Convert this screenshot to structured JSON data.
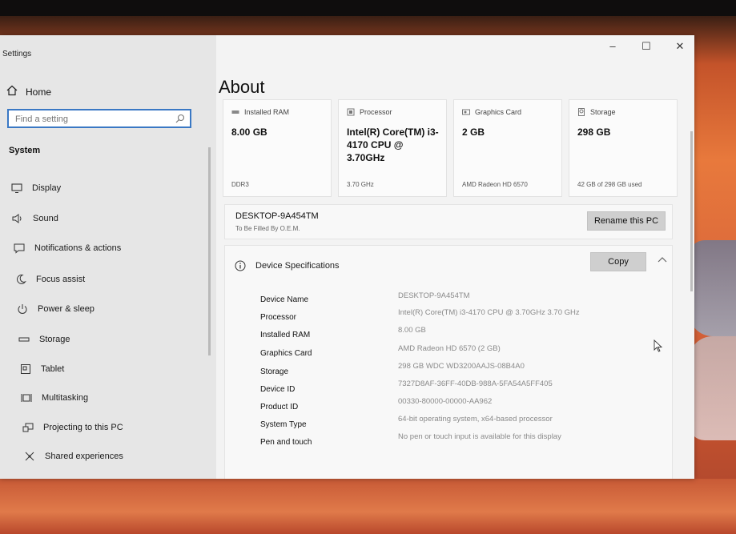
{
  "window": {
    "title": "Settings",
    "controls": {
      "minimize": "–",
      "maximize": "☐",
      "close": "✕"
    }
  },
  "sidebar": {
    "home_label": "Home",
    "search_placeholder": "Find a setting",
    "section_title": "System",
    "items": [
      {
        "label": "Display",
        "icon": "monitor-icon"
      },
      {
        "label": "Sound",
        "icon": "speaker-icon"
      },
      {
        "label": "Notifications & actions",
        "icon": "notification-icon"
      },
      {
        "label": "Focus assist",
        "icon": "moon-icon"
      },
      {
        "label": "Power & sleep",
        "icon": "power-icon"
      },
      {
        "label": "Storage",
        "icon": "storage-icon"
      },
      {
        "label": "Tablet",
        "icon": "tablet-icon"
      },
      {
        "label": "Multitasking",
        "icon": "multitasking-icon"
      },
      {
        "label": "Projecting to this PC",
        "icon": "projecting-icon"
      },
      {
        "label": "Shared experiences",
        "icon": "shared-icon"
      }
    ]
  },
  "main": {
    "title": "About",
    "cards": [
      {
        "label": "Installed RAM",
        "value": "8.00 GB",
        "sub": "DDR3",
        "icon": "ram-icon"
      },
      {
        "label": "Processor",
        "value": "Intel(R) Core(TM) i3-4170 CPU @ 3.70GHz",
        "sub": "3.70 GHz",
        "icon": "processor-icon"
      },
      {
        "label": "Graphics Card",
        "value": "2 GB",
        "sub": "AMD Radeon HD 6570",
        "icon": "graphics-card-icon"
      },
      {
        "label": "Storage",
        "value": "298 GB",
        "sub": "42 GB of 298 GB used",
        "icon": "storage-icon"
      }
    ],
    "pc": {
      "name": "DESKTOP-9A454TM",
      "subtitle": "To Be Filled By O.E.M.",
      "rename_label": "Rename this PC"
    },
    "specs": {
      "title": "Device Specifications",
      "copy_label": "Copy",
      "rows": [
        {
          "key": "Device Name",
          "value": "DESKTOP-9A454TM"
        },
        {
          "key": "Processor",
          "value": "Intel(R) Core(TM) i3-4170 CPU @ 3.70GHz   3.70 GHz"
        },
        {
          "key": "Installed RAM",
          "value": "8.00 GB"
        },
        {
          "key": "Graphics Card",
          "value": "AMD Radeon HD 6570 (2 GB)"
        },
        {
          "key": "Storage",
          "value": "298 GB WDC WD3200AAJS-08B4A0"
        },
        {
          "key": "Device ID",
          "value": "7327D8AF-36FF-40DB-988A-5FA54A5FF405"
        },
        {
          "key": "Product ID",
          "value": "00330-80000-00000-AA962"
        },
        {
          "key": "System Type",
          "value": "64-bit operating system, x64-based processor"
        },
        {
          "key": "Pen and touch",
          "value": "No pen or touch input is available for this display"
        }
      ]
    }
  }
}
